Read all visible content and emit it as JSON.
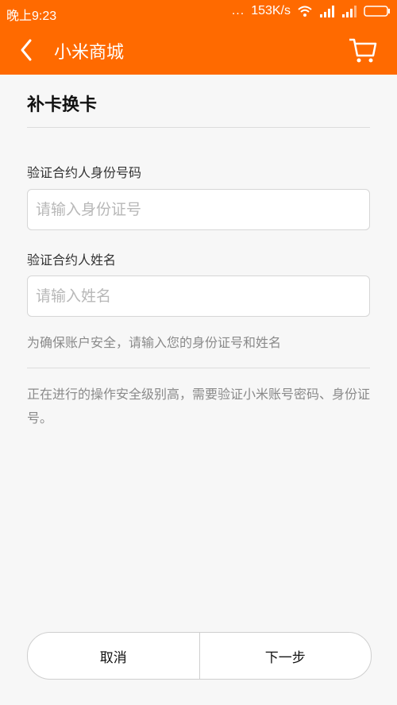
{
  "status_bar": {
    "time": "晚上9:23",
    "dots": "...",
    "speed": "153K/s"
  },
  "header": {
    "title": "小米商城",
    "back_icon": "back-chevron-icon",
    "cart_icon": "cart-icon"
  },
  "page": {
    "title": "补卡换卡"
  },
  "form": {
    "id_label": "验证合约人身份号码",
    "id_placeholder": "请输入身份证号",
    "name_label": "验证合约人姓名",
    "name_placeholder": "请输入姓名",
    "hint": "为确保账户安全，请输入您的身份证号和姓名",
    "notice": "正在进行的操作安全级别高，需要验证小米账号密码、身份证号。"
  },
  "buttons": {
    "cancel": "取消",
    "next": "下一步"
  },
  "colors": {
    "accent": "#ff6a00",
    "background": "#f7f7f7"
  }
}
